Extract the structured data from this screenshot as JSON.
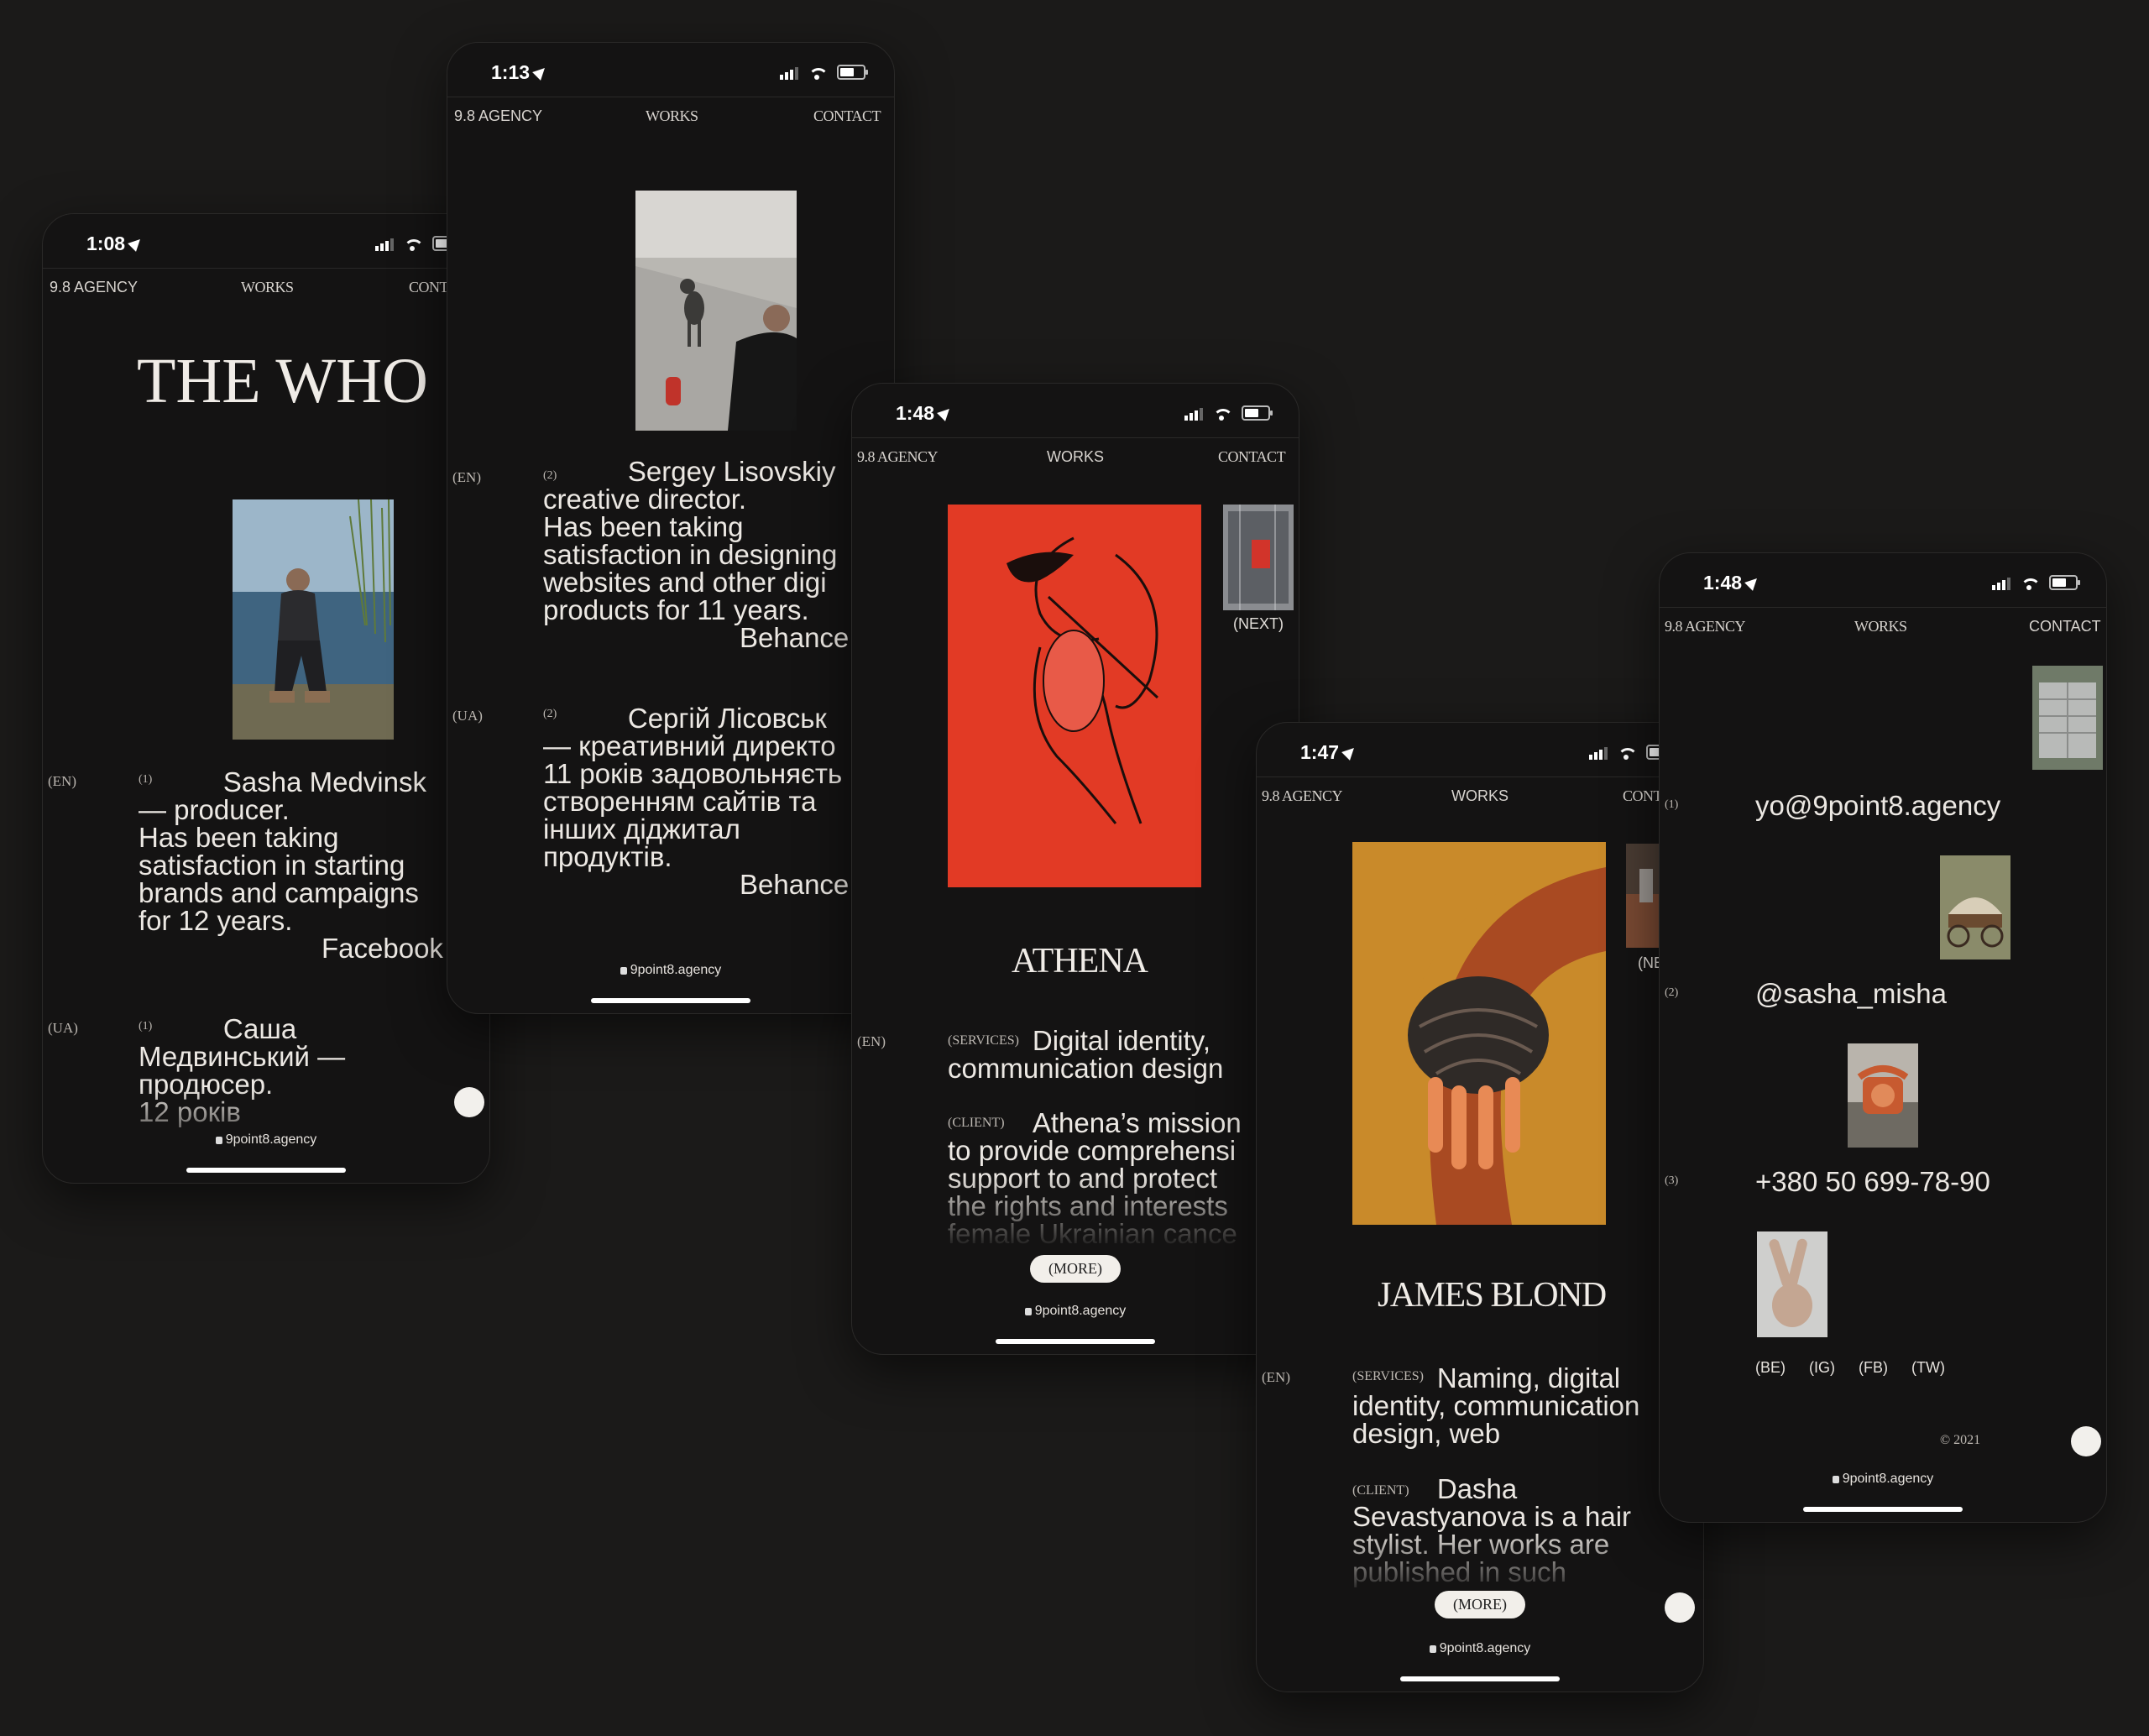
{
  "nav": {
    "brand": "9.8 AGENCY",
    "works": "WORKS",
    "contact": "CONTACT",
    "contact_clipped": "CON"
  },
  "footer": {
    "url": "9point8.agency"
  },
  "phone1": {
    "time": "1:08",
    "heading": "THE WHO",
    "lang_en": "(EN)",
    "lang_ua": "(UA)",
    "num_en": "(1)",
    "num_ua": "(1)",
    "text_en": "           Sasha Medvinsk\n— producer.\nHas been taking\nsatisfaction in starting\nbrands and campaigns\nfor 12 years.",
    "link_en": "Facebook",
    "text_ua": "           Саша\nМедвинський —\nпродюсер.\n12 років"
  },
  "phone2": {
    "time": "1:13",
    "lang_en": "(EN)",
    "lang_ua": "(UA)",
    "num_en": "(2)",
    "num_ua": "(2)",
    "text_en": "           Sergey Lisovskiy\ncreative director.\nHas been taking\nsatisfaction in designing\nwebsites and other digi\nproducts for 11 years.",
    "link_en": "Behance",
    "text_ua": "           Сергій Лісовськ\n— креативний директо\n11 років задовольняєть\nстворенням сайтів та\nінших діджитал\nпродуктів.",
    "link_ua": "Behance"
  },
  "phone3": {
    "time": "1:48",
    "next_label": "(NEXT)",
    "title": "ATHENA",
    "lang_en": "(EN)",
    "services_tag": "(SERVICES)",
    "services_text": "           Digital identity,\ncommunication design",
    "client_tag": "(CLIENT)",
    "client_text": "           Athena’s mission\nto provide comprehensi\nsupport to and protect\nthe rights and interests\nfemale Ukrainian cance",
    "more": "(MORE)"
  },
  "phone4": {
    "time": "1:47",
    "next_label": "(NE",
    "title": "JAMES BLOND",
    "lang_en": "(EN)",
    "services_tag": "(SERVICES)",
    "services_text": "           Naming, digital\nidentity, communication\ndesign, web",
    "client_tag": "(CLIENT)",
    "client_text": "           Dasha\nSevastyanova is a hair\nstylist. Her works are\npublished in such",
    "more": "(MORE)"
  },
  "phone5": {
    "time": "1:48",
    "num1": "(1)",
    "email": "yo@9point8.agency",
    "num2": "(2)",
    "handle": "@sasha_misha",
    "num3": "(3)",
    "phone": "+380 50 699-78-90",
    "socials": [
      "(BE)",
      "(IG)",
      "(FB)",
      "(TW)"
    ],
    "copyright": "© 2021"
  },
  "colors": {
    "background": "#1b1a19",
    "screen": "#141313",
    "athena_red": "#e23a25",
    "james_ochre": "#c98a2a",
    "james_orange": "#a94a22"
  },
  "icons": [
    "location-arrow-icon",
    "signal-icon",
    "wifi-icon",
    "battery-icon",
    "lock-icon"
  ]
}
